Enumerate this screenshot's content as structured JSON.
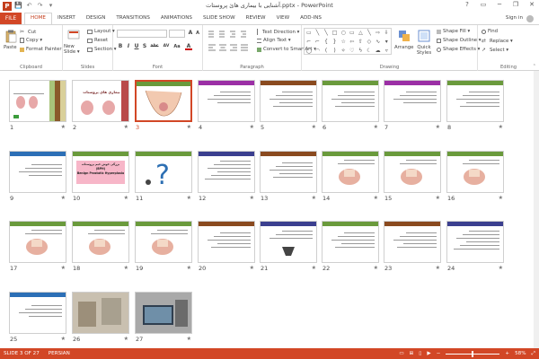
{
  "window": {
    "title": "آشنایی با بیماری هائ پروستات.pptx - PowerPoint",
    "controls": [
      "?",
      "▭",
      "─",
      "❐",
      "✕"
    ]
  },
  "qat": {
    "logo": "P",
    "buttons": [
      "💾",
      "↶",
      "↷",
      "▾"
    ]
  },
  "tabs": {
    "file": "FILE",
    "items": [
      "HOME",
      "INSERT",
      "DESIGN",
      "TRANSITIONS",
      "ANIMATIONS",
      "SLIDE SHOW",
      "REVIEW",
      "VIEW",
      "ADD-INS"
    ],
    "active_index": 0,
    "signin": "Sign in"
  },
  "ribbon": {
    "clipboard": {
      "label": "Clipboard",
      "paste": "Paste",
      "cut": "Cut",
      "copy": "Copy ▾",
      "format_painter": "Format Painter"
    },
    "slides": {
      "label": "Slides",
      "new_slide": "New Slide ▾",
      "layout": "Layout ▾",
      "reset": "Reset",
      "section": "Section ▾"
    },
    "font": {
      "label": "Font",
      "font_name": "",
      "font_size": "",
      "format_buttons": [
        "B",
        "I",
        "U",
        "S",
        "abc",
        "AV",
        "Aa",
        "A"
      ]
    },
    "paragraph": {
      "label": "Paragraph",
      "text_direction": "Text Direction ▾",
      "align_text": "Align Text ▾",
      "convert_smartart": "Convert to SmartArt ▾"
    },
    "drawing": {
      "label": "Drawing",
      "arrange": "Arrange",
      "quick_styles": "Quick Styles",
      "shape_fill": "Shape Fill ▾",
      "shape_outline": "Shape Outline ▾",
      "shape_effects": "Shape Effects ▾"
    },
    "editing": {
      "label": "Editing",
      "find": "Find",
      "replace": "Replace ▾",
      "select": "Select ▾"
    }
  },
  "slides": [
    {
      "num": "1"
    },
    {
      "num": "2"
    },
    {
      "num": "3"
    },
    {
      "num": "4"
    },
    {
      "num": "5"
    },
    {
      "num": "6"
    },
    {
      "num": "7"
    },
    {
      "num": "8"
    },
    {
      "num": "9"
    },
    {
      "num": "10"
    },
    {
      "num": "11"
    },
    {
      "num": "12"
    },
    {
      "num": "13"
    },
    {
      "num": "14"
    },
    {
      "num": "15"
    },
    {
      "num": "16"
    },
    {
      "num": "17"
    },
    {
      "num": "18"
    },
    {
      "num": "19"
    },
    {
      "num": "20"
    },
    {
      "num": "21"
    },
    {
      "num": "22"
    },
    {
      "num": "23"
    },
    {
      "num": "24"
    },
    {
      "num": "25"
    },
    {
      "num": "26"
    },
    {
      "num": "27"
    }
  ],
  "slide_titles": {
    "s2": "بیماری های پروستات",
    "s10_line1": "بزرگی خوش خیم پروستات",
    "s10_line2": "(BPH)",
    "s10_line3": "Benign Prostatic Hyperplasia"
  },
  "selected_slide": "3",
  "status": {
    "slide_info": "SLIDE 3 OF 27",
    "language": "PERSIAN",
    "zoom": "58%",
    "zoom_minus": "−",
    "zoom_plus": "+"
  },
  "colors": {
    "accent": "#d24726",
    "bar_purple": "#9b2fa5",
    "bar_green": "#6a9a3c",
    "bar_blue": "#2c6fb6",
    "bar_brown": "#8a4a1f",
    "bar_navy": "#3b3f8f"
  }
}
